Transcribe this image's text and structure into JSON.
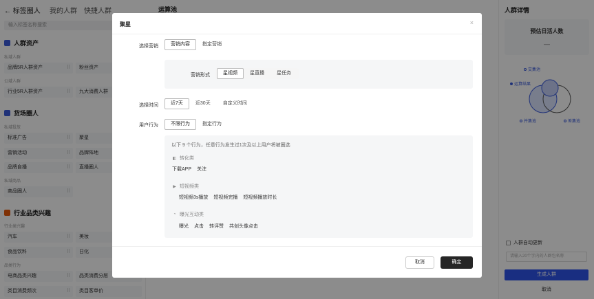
{
  "header": {
    "back_label": "← 标签圈人",
    "tabs": [
      "我的人群",
      "快捷人群"
    ],
    "middle_title": "运算池",
    "right_title": "人群详情"
  },
  "left_panel": {
    "search_placeholder": "输入标签名称搜索",
    "sections": [
      {
        "title": "人群资产",
        "color": "#3b5bdb",
        "groups": [
          {
            "label": "私域人群",
            "cells": [
              "品牌5R人群资产",
              "粉丝资产"
            ]
          },
          {
            "label": "公域人群",
            "cells": [
              "行业5R人群资产",
              "九大消费人群"
            ]
          }
        ]
      },
      {
        "title": "货场圈人",
        "color": "#3b5bdb",
        "groups": [
          {
            "label": "私域投放",
            "cells": [
              "标准广告",
              "聚星",
              "营销活动",
              "品牌阵地",
              "品牌自播",
              "直播圈人"
            ]
          },
          {
            "label": "私域商品",
            "cells": [
              "商品圈人"
            ]
          }
        ]
      },
      {
        "title": "行业品类兴趣",
        "color": "#e8590c",
        "groups": [
          {
            "label": "行业类兴趣",
            "cells": [
              "汽车",
              "美妆",
              "食品饮料",
              "日化"
            ]
          },
          {
            "label": "品类行为",
            "cells": [
              "电商品类兴趣",
              "品类消费分层",
              "类目消费频次",
              "类目客单价"
            ]
          }
        ]
      }
    ]
  },
  "right_panel": {
    "card_label": "预估日活人数",
    "card_value": "—",
    "venn": {
      "intersection": "交集池",
      "union": "运算结果",
      "parallel": "并集池",
      "difference": "差集池"
    },
    "auto_update_label": "人群自动更新",
    "name_placeholder": "请输入20个字内的人群包名称",
    "primary_label": "生成人群",
    "cancel_label": "取消"
  },
  "modal": {
    "title": "聚星",
    "close_glyph": "×",
    "marketing": {
      "label": "选择营销",
      "options": [
        "营销内容",
        "指定营销"
      ],
      "selected": "营销内容",
      "form_label": "营销形式",
      "form_options": [
        "星视频",
        "星直播",
        "星任务"
      ],
      "form_selected": "星视频"
    },
    "time": {
      "label": "选择时间",
      "options": [
        "近7天",
        "近30天",
        "自定义时间"
      ],
      "selected": "近7天"
    },
    "behavior": {
      "label": "用户行为",
      "options": [
        "不限行为",
        "指定行为"
      ],
      "selected": "不限行为",
      "description": "以下 9 个行为，任意行为发生过1次及以上用户将被圈选",
      "groups": [
        {
          "name": "转化类",
          "icon": "conversion-icon",
          "items": [
            "下载APP",
            "关注"
          ]
        },
        {
          "name": "短视频类",
          "icon": "video-icon",
          "items": [
            "短视频3s播放",
            "短视频完播",
            "短视频播放时长"
          ]
        },
        {
          "name": "曝光互动类",
          "icon": "exposure-icon",
          "items": [
            "曝光",
            "点击",
            "转评赞",
            "共创头像点击"
          ]
        }
      ]
    },
    "footer": {
      "cancel_label": "取消",
      "ok_label": "确定"
    }
  }
}
